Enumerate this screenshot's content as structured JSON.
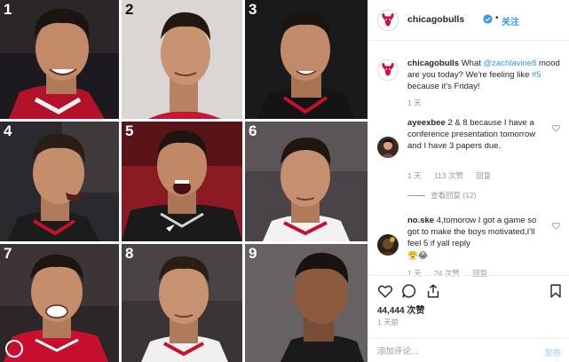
{
  "grid": {
    "tiles": [
      {
        "number": "1"
      },
      {
        "number": "2"
      },
      {
        "number": "3"
      },
      {
        "number": "4"
      },
      {
        "number": "5"
      },
      {
        "number": "6"
      },
      {
        "number": "7"
      },
      {
        "number": "8"
      },
      {
        "number": "9"
      }
    ]
  },
  "header": {
    "account": "chicagobulls",
    "separator": "•",
    "follow_label": "关注",
    "avatar_icon": "bulls-logo-icon"
  },
  "caption": {
    "author": "chicagobulls",
    "before": "What ",
    "mention": "@zachlavine8",
    "middle": " mood are you today? We're feeling like ",
    "hashtag": "#5",
    "after": " because it's Friday!",
    "time": "1 天"
  },
  "comments": [
    {
      "username": "ayeexbee",
      "text": "2 & 8 because I have a conference presentation tomorrow and I have 3 papers due.",
      "time": "1 天",
      "likes": "113 次赞",
      "reply": "回复",
      "view_replies": "查看回复 (12)"
    },
    {
      "username": "no.ske",
      "text": "4,tomorow I got a game so got to make the boys motivated,I'll feel 5 if yall reply",
      "emoji": "😤😂",
      "time": "1 天",
      "likes": "24 次赞",
      "reply": "回复"
    }
  ],
  "actions": {
    "likes_count": "44,444 次赞",
    "post_date": "1 天前",
    "comment_placeholder": "添加评论...",
    "post_label": "发布"
  },
  "colors": {
    "link": "#3897f0",
    "bulls_red": "#ce1141",
    "muted": "#999999"
  }
}
